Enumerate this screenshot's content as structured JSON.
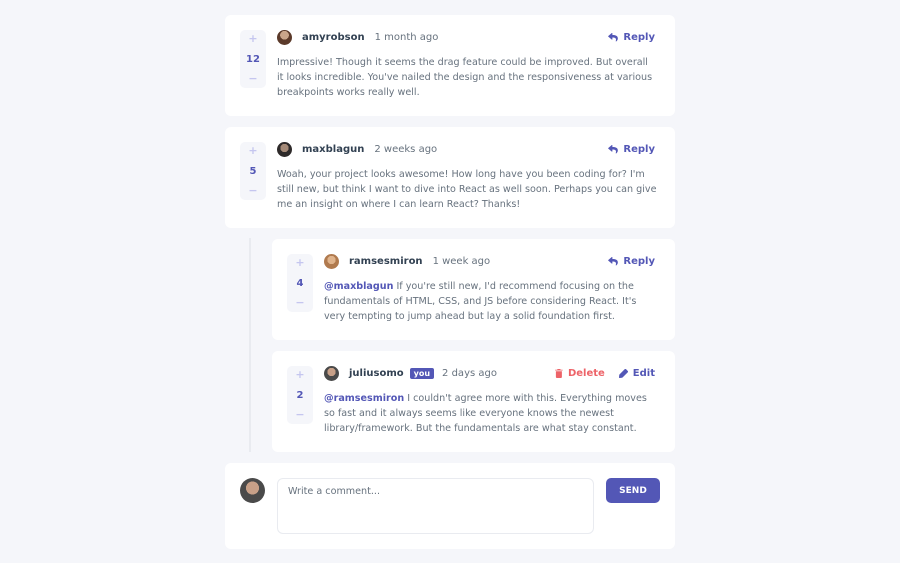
{
  "comments": [
    {
      "score": "12",
      "username": "amyrobson",
      "time": "1 month ago",
      "reply_label": "Reply",
      "text": "Impressive! Though it seems the drag feature could be improved. But overall it looks incredible. You've nailed the design and the responsiveness at various breakpoints works really well."
    },
    {
      "score": "5",
      "username": "maxblagun",
      "time": "2 weeks ago",
      "reply_label": "Reply",
      "text": "Woah, your project looks awesome! How long have you been coding for? I'm still new, but think I want to dive into React as well soon. Perhaps you can give me an insight on where I can learn React? Thanks!"
    }
  ],
  "replies": [
    {
      "score": "4",
      "username": "ramsesmiron",
      "time": "1 week ago",
      "reply_label": "Reply",
      "mention": "@maxblagun",
      "text": " If you're still new, I'd recommend focusing on the fundamentals of HTML, CSS, and JS before considering React. It's very tempting to jump ahead but lay a solid foundation first."
    },
    {
      "score": "2",
      "username": "juliusomo",
      "you_badge": "you",
      "time": "2 days ago",
      "delete_label": "Delete",
      "edit_label": "Edit",
      "mention": "@ramsesmiron",
      "text": " I couldn't agree more with this. Everything moves so fast and it always seems like everyone knows the newest library/framework. But the fundamentals are what stay constant."
    }
  ],
  "vote": {
    "plus": "+",
    "minus": "−"
  },
  "composer": {
    "placeholder": "Write a comment...",
    "send_label": "SEND"
  },
  "colors": {
    "accent": "#5357b6",
    "danger": "#ed6368",
    "background": "#f5f6fa"
  },
  "icons": {
    "reply": "reply-icon",
    "delete": "trash-icon",
    "edit": "pencil-icon"
  }
}
